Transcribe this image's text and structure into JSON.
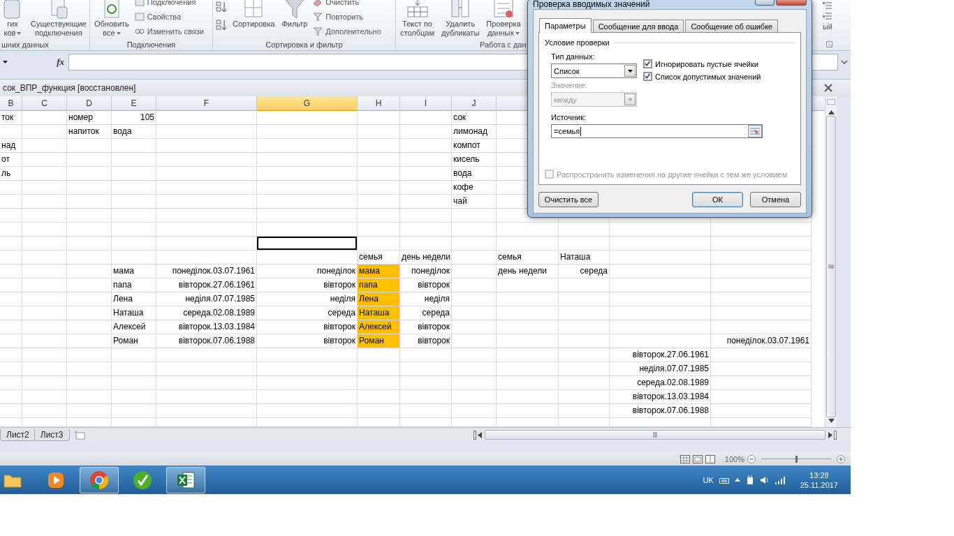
{
  "ribbon": {
    "groups": [
      {
        "label": "шних данных",
        "items": [
          {
            "kind": "big",
            "lines": [
              "гих",
              "ков"
            ],
            "caret": true
          },
          {
            "kind": "big",
            "lines": [
              "Существующие",
              "подключения"
            ],
            "caret": false
          }
        ]
      },
      {
        "label": "Подключения",
        "items": [
          {
            "kind": "big",
            "lines": [
              "Обновить",
              "все"
            ],
            "caret": true
          },
          {
            "kind": "stack",
            "entries": [
              "Подключения",
              "Свойства",
              "Изменить связи"
            ]
          }
        ]
      },
      {
        "label": "Сортировка и фильтр",
        "items": [
          {
            "kind": "sort"
          },
          {
            "kind": "big",
            "lines": [
              "Сортировка"
            ],
            "caret": false
          },
          {
            "kind": "big",
            "lines": [
              "Фильтр"
            ],
            "caret": false
          },
          {
            "kind": "stack",
            "entries": [
              "Очистить",
              "Повторить",
              "Дополнительно"
            ]
          }
        ]
      },
      {
        "label": "Работа с дан",
        "items": [
          {
            "kind": "big",
            "lines": [
              "Текст по",
              "столбцам"
            ],
            "caret": false
          },
          {
            "kind": "big",
            "lines": [
              "Удалить",
              "дубликаты"
            ],
            "caret": false
          },
          {
            "kind": "big",
            "lines": [
              "Проверка",
              "данных"
            ],
            "caret": true
          }
        ]
      }
    ],
    "cut_text": "ый"
  },
  "formula_bar": {
    "function_label": "fx"
  },
  "workbook": {
    "title": "сок_ВПР_функция [восстановлен]"
  },
  "columns": [
    {
      "label": "B",
      "selected": false
    },
    {
      "label": "C",
      "selected": false
    },
    {
      "label": "D",
      "selected": false
    },
    {
      "label": "E",
      "selected": false
    },
    {
      "label": "F",
      "selected": false
    },
    {
      "label": "G",
      "selected": true
    },
    {
      "label": "H",
      "selected": false
    },
    {
      "label": "I",
      "selected": false
    },
    {
      "label": "J",
      "selected": false
    },
    {
      "selected": false
    }
  ],
  "rows": [
    {
      "cells": [
        {
          "text": "ток",
          "kind": "text"
        },
        {},
        {
          "text": "номер",
          "kind": "text"
        },
        {
          "text": "105",
          "kind": "number"
        },
        {},
        {},
        {},
        {},
        {
          "text": "сок",
          "kind": "text"
        }
      ]
    },
    {
      "cells": [
        {},
        {},
        {
          "text": "напиток",
          "kind": "text"
        },
        {
          "text": "вода",
          "kind": "text"
        },
        {},
        {},
        {},
        {},
        {
          "text": "лимонад",
          "kind": "text"
        }
      ]
    },
    {
      "cells": [
        {
          "text": "над",
          "kind": "text"
        },
        {},
        {},
        {},
        {},
        {},
        {},
        {},
        {
          "text": "компот",
          "kind": "text"
        }
      ]
    },
    {
      "cells": [
        {
          "text": "от",
          "kind": "text"
        },
        {},
        {},
        {},
        {},
        {},
        {},
        {},
        {
          "text": "кисель",
          "kind": "text"
        }
      ]
    },
    {
      "cells": [
        {
          "text": "ль",
          "kind": "text"
        },
        {},
        {},
        {},
        {},
        {},
        {},
        {},
        {
          "text": "вода",
          "kind": "text"
        }
      ]
    },
    {
      "cells": [
        {},
        {},
        {},
        {},
        {},
        {},
        {},
        {},
        {
          "text": "кофе",
          "kind": "text"
        }
      ]
    },
    {
      "cells": [
        {},
        {},
        {},
        {},
        {},
        {},
        {},
        {},
        {
          "text": "чай",
          "kind": "text"
        }
      ]
    },
    {},
    {},
    {
      "cells": [
        {},
        {},
        {},
        {},
        {},
        {
          "selected": true
        }
      ]
    },
    {
      "cells": [
        {},
        {},
        {},
        {},
        {},
        {},
        {
          "text": "семья",
          "kind": "text"
        },
        {
          "text": "день недели",
          "kind": "text"
        },
        {},
        {
          "text": "семья",
          "kind": "text"
        },
        {
          "text": "Наташа",
          "kind": "text"
        }
      ]
    },
    {
      "cells": [
        {},
        {},
        {},
        {
          "text": "мама",
          "kind": "text"
        },
        {
          "text": "понеділок.03.07.1961",
          "kind": "number"
        },
        {
          "text": "понеділок",
          "kind": "number"
        },
        {
          "text": "мама",
          "kind": "text",
          "color": "#ffc000"
        },
        {
          "text": "понеділок",
          "kind": "number"
        },
        {},
        {
          "text": "день недели",
          "kind": "text"
        },
        {
          "text": "середа",
          "kind": "number"
        }
      ]
    },
    {
      "cells": [
        {},
        {},
        {},
        {
          "text": "папа",
          "kind": "text"
        },
        {
          "text": "вівторок.27.06.1961",
          "kind": "number"
        },
        {
          "text": "вівторок",
          "kind": "number"
        },
        {
          "text": "папа",
          "kind": "text",
          "color": "#ffc000"
        },
        {
          "text": "вівторок",
          "kind": "number"
        }
      ]
    },
    {
      "cells": [
        {},
        {},
        {},
        {
          "text": "Лена",
          "kind": "text"
        },
        {
          "text": "неділя.07.07.1985",
          "kind": "number"
        },
        {
          "text": "неділя",
          "kind": "number"
        },
        {
          "text": "Лена",
          "kind": "text",
          "color": "#ffc000"
        },
        {
          "text": "неділя",
          "kind": "number"
        }
      ]
    },
    {
      "cells": [
        {},
        {},
        {},
        {
          "text": "Наташа",
          "kind": "text"
        },
        {
          "text": "середа.02.08.1989",
          "kind": "number"
        },
        {
          "text": "середа",
          "kind": "number"
        },
        {
          "text": "Наташа",
          "kind": "text",
          "color": "#ffc000"
        },
        {
          "text": "середа",
          "kind": "number"
        }
      ]
    },
    {
      "cells": [
        {},
        {},
        {},
        {
          "text": "Алексей",
          "kind": "text"
        },
        {
          "text": "вівторок.13.03.1984",
          "kind": "number"
        },
        {
          "text": "вівторок",
          "kind": "number"
        },
        {
          "text": "Алексей",
          "kind": "text",
          "color": "#ffc000"
        },
        {
          "text": "вівторок",
          "kind": "number"
        }
      ]
    },
    {
      "cells": [
        {},
        {},
        {},
        {
          "text": "Роман",
          "kind": "text"
        },
        {
          "text": "вівторок.07.06.1988",
          "kind": "number"
        },
        {
          "text": "вівторок",
          "kind": "number"
        },
        {
          "text": "Роман",
          "kind": "text",
          "color": "#ffc000"
        },
        {
          "text": "вівторок",
          "kind": "number"
        },
        {},
        {},
        {},
        {},
        {
          "text": "понеділок.03.07.1961",
          "kind": "number"
        }
      ]
    },
    {
      "cells": [
        {},
        {},
        {},
        {},
        {},
        {},
        {},
        {},
        {},
        {},
        {},
        {
          "text": "вівторок.27.06.1961",
          "kind": "number"
        }
      ]
    },
    {
      "cells": [
        {},
        {},
        {},
        {},
        {},
        {},
        {},
        {},
        {},
        {},
        {},
        {
          "text": "неділя.07.07.1985",
          "kind": "number"
        }
      ]
    },
    {
      "cells": [
        {},
        {},
        {},
        {},
        {},
        {},
        {},
        {},
        {},
        {},
        {},
        {
          "text": "середа.02.08.1989",
          "kind": "number"
        }
      ]
    },
    {
      "cells": [
        {},
        {},
        {},
        {},
        {},
        {},
        {},
        {},
        {},
        {},
        {},
        {
          "text": "вівторок.13.03.1984",
          "kind": "number"
        }
      ]
    },
    {
      "cells": [
        {},
        {},
        {},
        {},
        {},
        {},
        {},
        {},
        {},
        {},
        {},
        {
          "text": "вівторок.07.06.1988",
          "kind": "number"
        }
      ]
    }
  ],
  "sheet_tabs": [
    {
      "label": "Лист2",
      "selected": false
    },
    {
      "label": "Лист3",
      "selected": false
    }
  ],
  "status_bar": {
    "zoom": "100%",
    "zoom_slider": {
      "level": 0.5
    }
  },
  "taskbar": {
    "apps": [
      {
        "running": false
      },
      {
        "running": false
      },
      {
        "running": true
      },
      {
        "running": false
      },
      {
        "running": true
      }
    ],
    "language": "UK",
    "time": "13:28",
    "date": "25.11.2017"
  },
  "dialog": {
    "title": "Проверка вводимых значений",
    "tabs": [
      {
        "label": "Параметры",
        "selected": true
      },
      {
        "label": "Сообщение для ввода",
        "selected": false
      },
      {
        "label": "Сообщение об ошибке",
        "selected": false
      }
    ],
    "section": "Условие проверки",
    "type_label": "Тип данных:",
    "type_value": "Список",
    "checkboxes": [
      {
        "label": "Игнорировать пустые ячейки",
        "checked": true
      },
      {
        "label": "Список допустимых значений",
        "checked": true
      }
    ],
    "value_label": "Значение:",
    "value_select": {
      "value": "между",
      "disabled": true
    },
    "source_label": "Источник:",
    "source_value": "=семья",
    "apply_all": {
      "label": "Распространить изменения на другие ячейки с тем же условием",
      "checked": false,
      "disabled": true
    },
    "buttons": [
      {
        "label": "Очистить все",
        "default": false
      },
      {
        "label": "ОК",
        "default": true
      },
      {
        "label": "Отмена",
        "default": false
      }
    ]
  }
}
